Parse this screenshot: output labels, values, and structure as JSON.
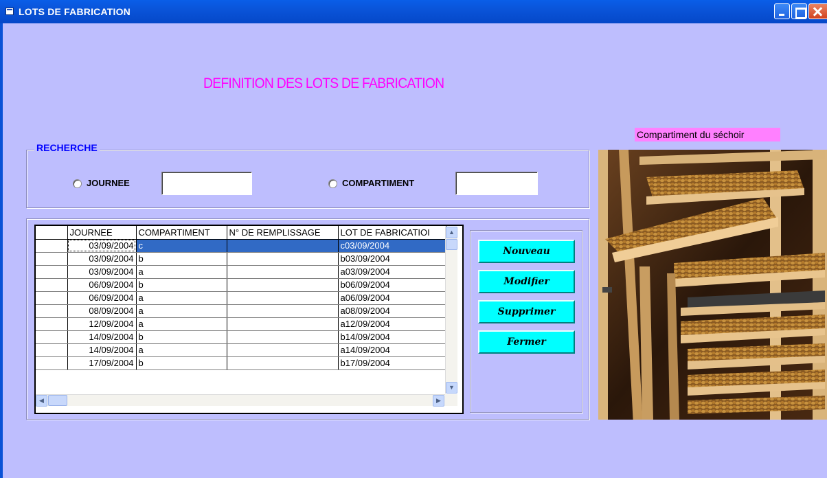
{
  "window": {
    "title": "LOTS DE FABRICATION"
  },
  "heading": "DEFINITION DES LOTS DE FABRICATION",
  "search": {
    "legend": "RECHERCHE",
    "journee_label": "JOURNEE",
    "journee_value": "",
    "compartiment_label": "COMPARTIMENT",
    "compartiment_value": ""
  },
  "grid": {
    "columns": [
      "JOURNEE",
      "COMPARTIMENT",
      "N° DE REMPLISSAGE",
      "LOT DE FABRICATIOI"
    ],
    "rows": [
      {
        "journee": "03/09/2004",
        "compartiment": "c",
        "remplissage": "",
        "lot": "c03/09/2004"
      },
      {
        "journee": "03/09/2004",
        "compartiment": "b",
        "remplissage": "",
        "lot": "b03/09/2004"
      },
      {
        "journee": "03/09/2004",
        "compartiment": "a",
        "remplissage": "",
        "lot": "a03/09/2004"
      },
      {
        "journee": "06/09/2004",
        "compartiment": "b",
        "remplissage": "",
        "lot": "b06/09/2004"
      },
      {
        "journee": "06/09/2004",
        "compartiment": "a",
        "remplissage": "",
        "lot": "a06/09/2004"
      },
      {
        "journee": "08/09/2004",
        "compartiment": "a",
        "remplissage": "",
        "lot": "a08/09/2004"
      },
      {
        "journee": "12/09/2004",
        "compartiment": "a",
        "remplissage": "",
        "lot": "a12/09/2004"
      },
      {
        "journee": "14/09/2004",
        "compartiment": "b",
        "remplissage": "",
        "lot": "b14/09/2004"
      },
      {
        "journee": "14/09/2004",
        "compartiment": "a",
        "remplissage": "",
        "lot": "a14/09/2004"
      },
      {
        "journee": "17/09/2004",
        "compartiment": "b",
        "remplissage": "",
        "lot": "b17/09/2004"
      }
    ]
  },
  "buttons": {
    "nouveau": "Nouveau",
    "modifier": "Modifier",
    "supprimer": "Supprimer",
    "fermer": "Fermer"
  },
  "image_caption": "Compartiment du séchoir",
  "colors": {
    "background": "#bebefe",
    "heading": "#ff00ff",
    "legend": "#0000ff",
    "button": "#00ffff",
    "caption_bg": "#ff80ff",
    "selection": "#316ac5"
  }
}
